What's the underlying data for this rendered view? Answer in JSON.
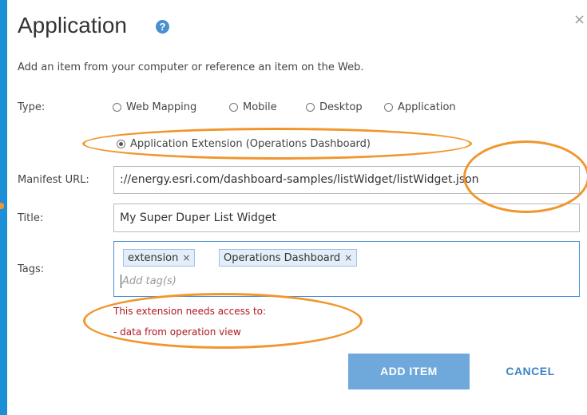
{
  "dialog": {
    "title": "Application",
    "help_icon": "?",
    "close_icon": "×",
    "description": "Add an item from your computer or reference an item on the Web."
  },
  "form": {
    "type_label": "Type:",
    "type_options": [
      {
        "label": "Web Mapping",
        "checked": false
      },
      {
        "label": "Mobile",
        "checked": false
      },
      {
        "label": "Desktop",
        "checked": false
      },
      {
        "label": "Application",
        "checked": false
      },
      {
        "label": "Application Extension (Operations Dashboard)",
        "checked": true
      }
    ],
    "manifest_url_label": "Manifest URL:",
    "manifest_url_value": "://energy.esri.com/dashboard-samples/listWidget/listWidget.json",
    "title_label": "Title:",
    "title_value": "My Super Duper List Widget",
    "tags_label": "Tags:",
    "tags": [
      {
        "label": "extension",
        "remove": "×"
      },
      {
        "label": "Operations Dashboard",
        "remove": "×"
      }
    ],
    "tags_placeholder": "Add tag(s)"
  },
  "warning": {
    "line1": "This extension needs access to:",
    "line2": "- data from operation view"
  },
  "buttons": {
    "add_item": "ADD ITEM",
    "cancel": "CANCEL"
  },
  "colors": {
    "background": "#1d8fd6",
    "annotation": "#f0962d",
    "primary_button": "#6fa9dc",
    "warning_text": "#b0171f"
  }
}
